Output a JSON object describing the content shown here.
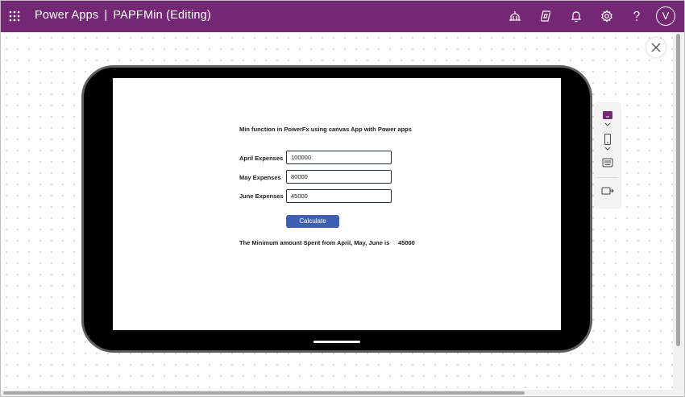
{
  "header": {
    "app_name": "Power Apps",
    "separator": "|",
    "doc_title": "PAPFMin (Editing)",
    "avatar_initial": "V",
    "icons": [
      "app-launcher-icon",
      "environment-icon",
      "copilot-icon",
      "notifications-icon",
      "settings-icon",
      "help-icon"
    ]
  },
  "colors": {
    "header_bg": "#742774",
    "button_bg": "#3f5fb4",
    "input_border": "#222c4d",
    "device_frame": "#000000"
  },
  "app": {
    "title": "Min function in PowerFx using canvas App with Power apps",
    "fields": [
      {
        "label": "April Expenses",
        "value": "100000"
      },
      {
        "label": "May Expenses",
        "value": "80000"
      },
      {
        "label": "June Expenses",
        "value": "45000"
      }
    ],
    "button_label": "Calculate",
    "result_label": "The Minimum amount Spent from April, May, June is",
    "result_value": "45000"
  },
  "side_panel": {
    "icons": [
      "screen-color-icon",
      "chevron-down-icon",
      "phone-icon",
      "chevron-down-icon",
      "keyboard-icon",
      "preview-exit-icon"
    ]
  }
}
